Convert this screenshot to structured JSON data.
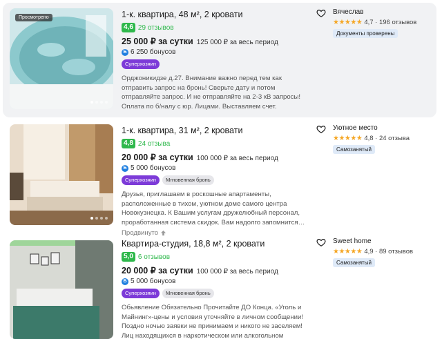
{
  "listings": [
    {
      "viewed_label": "Просмотрено",
      "title": "1-к. квартира, 48 м², 2 кровати",
      "score": "4,6",
      "reviews": "29 отзывов",
      "price": "25 000 ₽ за сутки",
      "total": "125 000 ₽ за весь период",
      "bonus": "6 250 бонусов",
      "tags": [
        "Суперхозяин"
      ],
      "description": "Орджоникидзе д.27. Внимание важно перед тем как отправить запрос на бронь! Сверьте дату и потом отправляйте запрос. И не отправляйте на 2-3 кВ запросы! Оплата по б/налу с юр. Лицами. Выставляем счет. Предоставляем онлайн-чеки и…",
      "promoted": "",
      "host_name": "Вячеслав",
      "host_rating": "4,7 · 196 отзывов",
      "host_badge": "Документы проверены",
      "photo_colors": [
        "#6fb3b8",
        "#d7eef0"
      ]
    },
    {
      "viewed_label": "",
      "title": "1-к. квартира, 31 м², 2 кровати",
      "score": "4,8",
      "reviews": "24 отзыва",
      "price": "20 000 ₽ за сутки",
      "total": "100 000 ₽ за весь период",
      "bonus": "5 000 бонусов",
      "tags": [
        "Суперхозяин",
        "Мгновенная бронь"
      ],
      "description": "Друзья, приглашаем в роскошные апартаменты, расположенные в тихом, уютном доме самого центра Новокузнецка. К Вашим услугам дружелюбный персонал, проработанная система скидок. Вам надолго запомнится…",
      "promoted": "Продвинуто",
      "host_name": "Уютное место",
      "host_rating": "4,8 · 24 отзыва",
      "host_badge": "Самозанятый",
      "photo_colors": [
        "#b98a5c",
        "#f1e4d0"
      ]
    },
    {
      "viewed_label": "",
      "title": "Квартира-студия, 18,8 м², 2 кровати",
      "score": "5,0",
      "reviews": "6 отзывов",
      "price": "20 000 ₽ за сутки",
      "total": "100 000 ₽ за весь период",
      "bonus": "5 000 бонусов",
      "tags": [
        "Суперхозяин",
        "Мгновенная бронь"
      ],
      "description": "Обьявление Обязательно Прочитайте ДО Конца. «Уголь и Майнинг»-цены и условия уточняйте в личном сообщении! Поздно ночью заявки не принимаем и никого не заселяем! Лиц находящихся в наркотическом или алкогольном опьянении не…",
      "promoted": "",
      "host_name": "Sweet home",
      "host_rating": "4,9 · 89 отзывов",
      "host_badge": "Самозанятый",
      "photo_colors": [
        "#5d7a70",
        "#c9d6c6"
      ]
    }
  ],
  "stars": "★★★★★",
  "bonus_icon": "Б",
  "colors": {
    "accent_green": "#2eb84b",
    "superhost_purple": "#7d3bd8",
    "star": "#f5a623",
    "bonus_blue": "#1f7fe0"
  },
  "icons": [
    "heart-icon",
    "bonus-icon",
    "star-icon",
    "arrow-up-icon"
  ]
}
